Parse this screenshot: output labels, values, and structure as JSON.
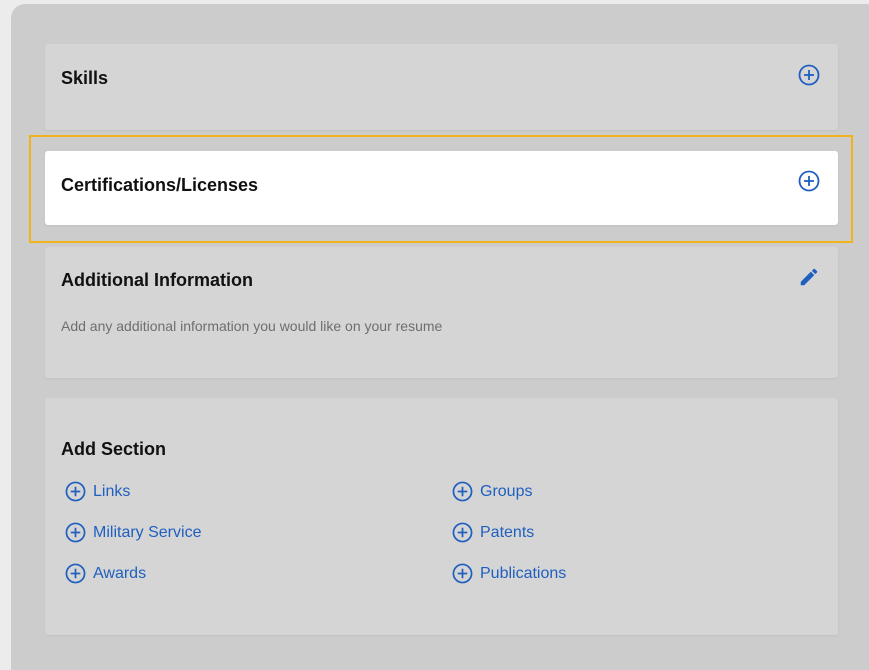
{
  "colors": {
    "accent_blue": "#1f5fbf",
    "highlight_outline": "#f0b31a",
    "card_bg": "#d5d5d5",
    "active_card_bg": "#ffffff"
  },
  "skills": {
    "title": "Skills",
    "add_icon": "plus-circle-icon"
  },
  "certifications": {
    "title": "Certifications/Licenses",
    "add_icon": "plus-circle-icon"
  },
  "additional_info": {
    "title": "Additional Information",
    "description": "Add any additional information you would like on your resume",
    "edit_icon": "pencil-icon"
  },
  "add_section": {
    "title": "Add Section",
    "links": [
      {
        "label": "Links"
      },
      {
        "label": "Groups"
      },
      {
        "label": "Military Service"
      },
      {
        "label": "Patents"
      },
      {
        "label": "Awards"
      },
      {
        "label": "Publications"
      }
    ]
  }
}
